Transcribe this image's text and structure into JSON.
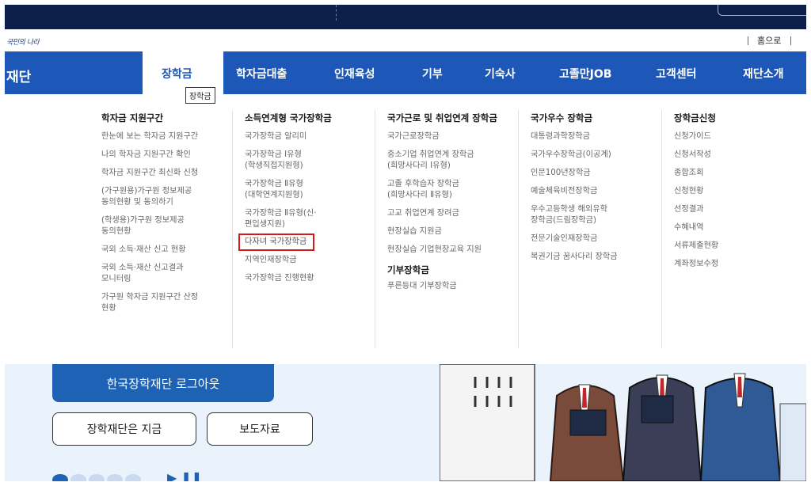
{
  "utility": {
    "logo_text": "국민의 나라",
    "home_label": "홈으로"
  },
  "nav": {
    "brand": "재단",
    "items": [
      {
        "label": "장학금",
        "active": true
      },
      {
        "label": "학자금대출"
      },
      {
        "label": "인재육성"
      },
      {
        "label": "기부"
      },
      {
        "label": "기숙사"
      },
      {
        "label": "고졸만JOB"
      },
      {
        "label": "고객센터"
      },
      {
        "label": "재단소개"
      }
    ],
    "tooltip": "장학금"
  },
  "menu": {
    "col1": {
      "title": "학자금 지원구간",
      "items": [
        [
          "한눈에 보는 학자금 지원구간"
        ],
        [
          "나의 학자금 지원구간 확인"
        ],
        [
          "학자금 지원구간 최신화 신청"
        ],
        [
          "(가구원용)가구원 정보제공",
          "동의현황 및 동의하기"
        ],
        [
          "(학생용)가구원 정보제공",
          "동의현황"
        ],
        [
          "국외 소득·재산 신고 현황"
        ],
        [
          "국외 소득·재산 신고결과",
          "모니터링"
        ],
        [
          "가구원 학자금 지원구간 산정",
          "현황"
        ]
      ]
    },
    "col2": {
      "title": "소득연계형 국가장학금",
      "items": [
        [
          "국가장학금 알리미"
        ],
        [
          "국가장학금 Ⅰ유형",
          "(학생직접지원형)"
        ],
        [
          "국가장학금 Ⅱ유형",
          "(대학연계지원형)"
        ],
        [
          "국가장학금 Ⅱ유형(신·",
          "편입생지원)"
        ],
        [
          "다자녀 국가장학금"
        ],
        [
          "지역인재장학금"
        ],
        [
          "국가장학금 진행현황"
        ]
      ]
    },
    "col3": {
      "title": "국가근로 및 취업연계 장학금",
      "items": [
        [
          "국가근로장학금"
        ],
        [
          "중소기업 취업연계 장학금",
          "(희망사다리 Ⅰ유형)"
        ],
        [
          "고졸 후학습자 장학금",
          "(희망사다리 Ⅱ유형)"
        ],
        [
          "고교 취업연계 장려금"
        ],
        [
          "현장실습 지원금"
        ],
        [
          "현장실습 기업현장교육 지원"
        ]
      ],
      "title2": "기부장학금",
      "items2": [
        [
          "푸른등대 기부장학금"
        ]
      ]
    },
    "col4": {
      "title": "국가우수 장학금",
      "items": [
        [
          "대통령과학장학금"
        ],
        [
          "국가우수장학금(이공계)"
        ],
        [
          "인문100년장학금"
        ],
        [
          "예술체육비전장학금"
        ],
        [
          "우수고등학생 해외유학",
          "장학금(드림장학금)"
        ],
        [
          "전문기술인재장학금"
        ],
        [
          "복권기금 꿈사다리 장학금"
        ]
      ]
    },
    "col5": {
      "title": "장학금신청",
      "items": [
        [
          "신청가이드"
        ],
        [
          "신청서작성"
        ],
        [
          "종합조회"
        ],
        [
          "신청현황"
        ],
        [
          "선정결과"
        ],
        [
          "수혜내역"
        ],
        [
          "서류제출현황"
        ],
        [
          "계좌정보수정"
        ]
      ]
    }
  },
  "lower": {
    "logout_label": "한국장학재단 로그아웃",
    "pill1": "장학재단은 지금",
    "pill2": "보도자료"
  },
  "colors": {
    "nav_blue": "#1d58b8",
    "dark_strip": "#0b1f4a",
    "highlight_red": "#d31a1a"
  }
}
